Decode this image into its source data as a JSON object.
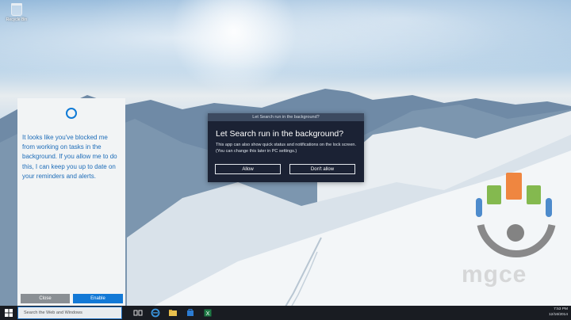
{
  "desktop": {
    "recycle_bin_label": "Recycle Bin"
  },
  "cortana_panel": {
    "message": "It looks like you've blocked me from working on tasks in the background. If you allow me to do this, I can keep you up to date on your reminders and alerts.",
    "close_label": "Close",
    "enable_label": "Enable"
  },
  "dialog": {
    "titlebar": "Let Search run in the background?",
    "heading": "Let Search run in the background?",
    "body": "This app can also show quick status and notifications on the lock screen. (You can change this later in PC settings.)",
    "allow_label": "Allow",
    "dont_allow_label": "Don't allow"
  },
  "taskbar": {
    "search_placeholder": "Search the Web and Windows",
    "time": "7:53 PM",
    "date": "12/16/2014",
    "icons": [
      "windows-logo-icon",
      "task-view-icon",
      "edge-icon",
      "file-explorer-icon",
      "store-icon",
      "excel-icon"
    ]
  },
  "watermark": {
    "brand": "mgce"
  },
  "colors": {
    "accent": "#1379d6",
    "cortana_text": "#1d6cb8",
    "dialog_bg": "#1b2234",
    "taskbar_bg": "#191c22"
  }
}
